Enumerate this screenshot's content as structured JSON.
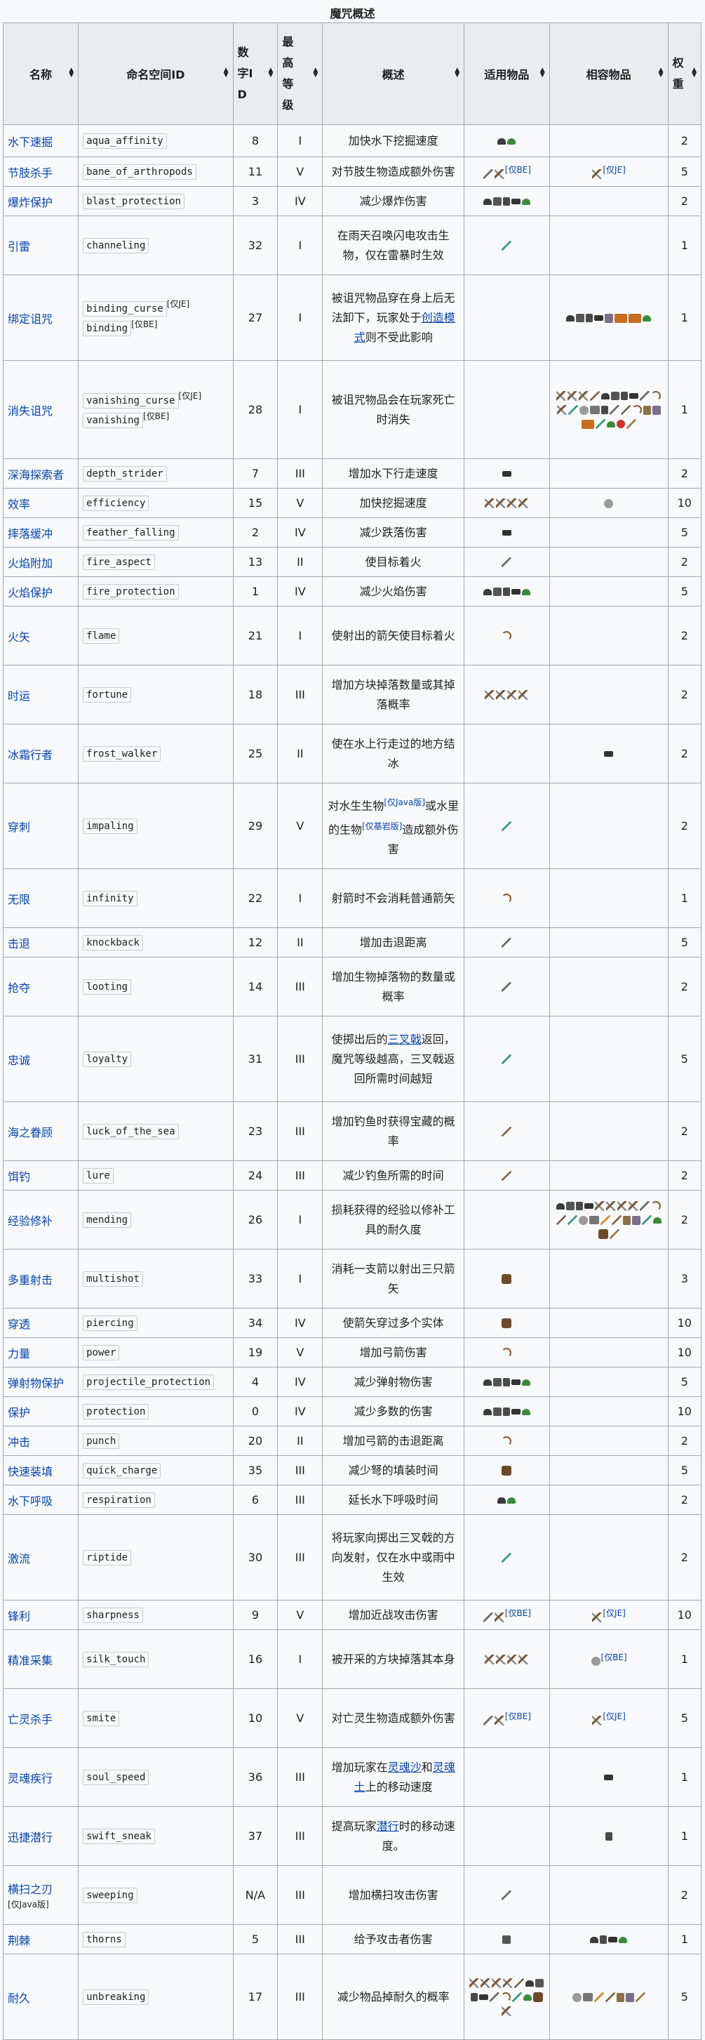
{
  "caption": "魔咒概述",
  "headers": {
    "name": "名称",
    "id": "命名空间ID",
    "num": "数字ID",
    "maxlvl": "最高等级",
    "summary": "概述",
    "items": "适用物品",
    "compat": "相容物品",
    "weight": "权重"
  },
  "icons_note": "Item icons shown as small pictograms",
  "rows": [
    {
      "name": "水下速掘",
      "ids": [
        "aqua_affinity"
      ],
      "num": "8",
      "lvl": "I",
      "summary": "加快水下挖掘速度",
      "wt": "2",
      "items": [
        "helm",
        "turtle"
      ],
      "compat": []
    },
    {
      "name": "节肢杀手",
      "ids": [
        "bane_of_arthropods"
      ],
      "num": "11",
      "lvl": "V",
      "summary": "对节肢生物造成额外伤害",
      "wt": "5",
      "items": [
        "sword",
        "pick"
      ],
      "items_note": "[仅BE]",
      "compat": [
        "pick"
      ],
      "compat_note": "[仅JE]"
    },
    {
      "name": "爆炸保护",
      "ids": [
        "blast_protection"
      ],
      "num": "3",
      "lvl": "IV",
      "summary": "减少爆炸伤害",
      "wt": "2",
      "items": [
        "helm",
        "chest",
        "legs",
        "boots",
        "turtle"
      ],
      "compat": []
    },
    {
      "name": "引雷",
      "ids": [
        "channeling"
      ],
      "num": "32",
      "lvl": "I",
      "summary": "在雨天召唤闪电攻击生物，仅在雷暴时生效",
      "wt": "1",
      "items": [
        "trident"
      ],
      "compat": []
    },
    {
      "name": "绑定诅咒",
      "ids": [
        "binding_curse",
        "binding"
      ],
      "id_notes": [
        "[仅JE]",
        "[仅BE]"
      ],
      "num": "27",
      "lvl": "I",
      "summary_parts": [
        "被诅咒物品穿在身上后无法卸下，玩家处于",
        "创造模式",
        "则不受此影响"
      ],
      "wt": "1",
      "items": [],
      "compat": [
        "helm",
        "chest",
        "legs",
        "boots",
        "elytra",
        "pump",
        "pump",
        "turtle"
      ]
    },
    {
      "name": "消失诅咒",
      "ids": [
        "vanishing_curse",
        "vanishing"
      ],
      "id_notes": [
        "[仅JE]",
        "[仅BE]"
      ],
      "num": "28",
      "lvl": "I",
      "summary": "被诅咒物品会在玩家死亡时消失",
      "wt": "1",
      "items": [],
      "compat": [
        "pick",
        "pick",
        "pick",
        "rod",
        "helm",
        "chest",
        "legs",
        "boots",
        "sword",
        "bow",
        "pick",
        "trident",
        "shears",
        "flint",
        "legs",
        "sword",
        "rod",
        "bow",
        "shield",
        "elytra",
        "pump",
        "trident",
        "turtle",
        "compass",
        "brush"
      ]
    },
    {
      "name": "深海探索者",
      "ids": [
        "depth_strider"
      ],
      "num": "7",
      "lvl": "III",
      "summary": "增加水下行走速度",
      "wt": "2",
      "items": [
        "boots"
      ],
      "compat": []
    },
    {
      "name": "效率",
      "ids": [
        "efficiency"
      ],
      "num": "15",
      "lvl": "V",
      "summary": "加快挖掘速度",
      "wt": "10",
      "items": [
        "pick",
        "pick",
        "pick",
        "pick"
      ],
      "compat": [
        "shears"
      ]
    },
    {
      "name": "摔落缓冲",
      "ids": [
        "feather_falling"
      ],
      "num": "2",
      "lvl": "IV",
      "summary": "减少跌落伤害",
      "wt": "5",
      "items": [
        "boots"
      ],
      "compat": []
    },
    {
      "name": "火焰附加",
      "ids": [
        "fire_aspect"
      ],
      "num": "13",
      "lvl": "II",
      "summary": "使目标着火",
      "wt": "2",
      "items": [
        "sword"
      ],
      "compat": []
    },
    {
      "name": "火焰保护",
      "ids": [
        "fire_protection"
      ],
      "num": "1",
      "lvl": "IV",
      "summary": "减少火焰伤害",
      "wt": "5",
      "items": [
        "helm",
        "chest",
        "legs",
        "boots",
        "turtle"
      ],
      "compat": []
    },
    {
      "name": "火矢",
      "ids": [
        "flame"
      ],
      "num": "21",
      "lvl": "I",
      "summary": "使射出的箭矢使目标着火",
      "wt": "2",
      "items": [
        "bow"
      ],
      "compat": []
    },
    {
      "name": "时运",
      "ids": [
        "fortune"
      ],
      "num": "18",
      "lvl": "III",
      "summary": "增加方块掉落数量或其掉落概率",
      "wt": "2",
      "items": [
        "pick",
        "pick",
        "pick",
        "pick"
      ],
      "compat": []
    },
    {
      "name": "冰霜行者",
      "ids": [
        "frost_walker"
      ],
      "num": "25",
      "lvl": "II",
      "summary": "使在水上行走过的地方结冰",
      "wt": "2",
      "items": [],
      "compat": [
        "boots"
      ]
    },
    {
      "name": "穿刺",
      "ids": [
        "impaling"
      ],
      "num": "29",
      "lvl": "V",
      "summary_parts": [
        "对水生生物",
        "[仅Java版]",
        "或水里的生物",
        "[仅基岩版]",
        "造成额外伤害"
      ],
      "wt": "2",
      "items": [
        "trident"
      ],
      "compat": []
    },
    {
      "name": "无限",
      "ids": [
        "infinity"
      ],
      "num": "22",
      "lvl": "I",
      "summary": "射箭时不会消耗普通箭矢",
      "wt": "1",
      "items": [
        "bow"
      ],
      "compat": []
    },
    {
      "name": "击退",
      "ids": [
        "knockback"
      ],
      "num": "12",
      "lvl": "II",
      "summary": "增加击退距离",
      "wt": "5",
      "items": [
        "sword"
      ],
      "compat": []
    },
    {
      "name": "抢夺",
      "ids": [
        "looting"
      ],
      "num": "14",
      "lvl": "III",
      "summary": "增加生物掉落物的数量或概率",
      "wt": "2",
      "items": [
        "sword"
      ],
      "compat": []
    },
    {
      "name": "忠诚",
      "ids": [
        "loyalty"
      ],
      "num": "31",
      "lvl": "III",
      "summary_parts": [
        "使掷出后的",
        "三叉戟",
        "返回，魔咒等级越高，三叉戟返回所需时间越短"
      ],
      "wt": "5",
      "items": [
        "trident"
      ],
      "compat": []
    },
    {
      "name": "海之眷顾",
      "ids": [
        "luck_of_the_sea"
      ],
      "num": "23",
      "lvl": "III",
      "summary": "增加钓鱼时获得宝藏的概率",
      "wt": "2",
      "items": [
        "rod"
      ],
      "compat": []
    },
    {
      "name": "饵钓",
      "ids": [
        "lure"
      ],
      "num": "24",
      "lvl": "III",
      "summary": "减少钓鱼所需的时间",
      "wt": "2",
      "items": [
        "rod"
      ],
      "compat": []
    },
    {
      "name": "经验修补",
      "ids": [
        "mending"
      ],
      "num": "26",
      "lvl": "I",
      "summary": "损耗获得的经验以修补工具的耐久度",
      "wt": "2",
      "items": [],
      "compat": [
        "helm",
        "chest",
        "legs",
        "boots",
        "pick",
        "pick",
        "pick",
        "pick",
        "sword",
        "bow",
        "rod",
        "trident",
        "shears",
        "flint",
        "carrot",
        "rod",
        "shield",
        "elytra",
        "trident",
        "turtle",
        "cross",
        "brush"
      ]
    },
    {
      "name": "多重射击",
      "ids": [
        "multishot"
      ],
      "num": "33",
      "lvl": "I",
      "summary": "消耗一支箭以射出三只箭矢",
      "wt": "3",
      "items": [
        "cross"
      ],
      "compat": []
    },
    {
      "name": "穿透",
      "ids": [
        "piercing"
      ],
      "num": "34",
      "lvl": "IV",
      "summary": "使箭矢穿过多个实体",
      "wt": "10",
      "items": [
        "cross"
      ],
      "compat": []
    },
    {
      "name": "力量",
      "ids": [
        "power"
      ],
      "num": "19",
      "lvl": "V",
      "summary": "增加弓箭伤害",
      "wt": "10",
      "items": [
        "bow"
      ],
      "compat": []
    },
    {
      "name": "弹射物保护",
      "ids": [
        "projectile_protection"
      ],
      "num": "4",
      "lvl": "IV",
      "summary": "减少弹射物伤害",
      "wt": "5",
      "items": [
        "helm",
        "chest",
        "legs",
        "boots",
        "turtle"
      ],
      "compat": []
    },
    {
      "name": "保护",
      "ids": [
        "protection"
      ],
      "num": "0",
      "lvl": "IV",
      "summary": "减少多数的伤害",
      "wt": "10",
      "items": [
        "helm",
        "chest",
        "legs",
        "boots",
        "turtle"
      ],
      "compat": []
    },
    {
      "name": "冲击",
      "ids": [
        "punch"
      ],
      "num": "20",
      "lvl": "II",
      "summary": "增加弓箭的击退距离",
      "wt": "2",
      "items": [
        "bow"
      ],
      "compat": []
    },
    {
      "name": "快速装填",
      "ids": [
        "quick_charge"
      ],
      "num": "35",
      "lvl": "III",
      "summary": "减少弩的填装时间",
      "wt": "5",
      "items": [
        "cross"
      ],
      "compat": []
    },
    {
      "name": "水下呼吸",
      "ids": [
        "respiration"
      ],
      "num": "6",
      "lvl": "III",
      "summary": "延长水下呼吸时间",
      "wt": "2",
      "items": [
        "helm",
        "turtle"
      ],
      "compat": []
    },
    {
      "name": "激流",
      "ids": [
        "riptide"
      ],
      "num": "30",
      "lvl": "III",
      "summary": "将玩家向掷出三叉戟的方向发射，仅在水中或雨中生效",
      "wt": "2",
      "items": [
        "trident"
      ],
      "compat": []
    },
    {
      "name": "锋利",
      "ids": [
        "sharpness"
      ],
      "num": "9",
      "lvl": "V",
      "summary": "增加近战攻击伤害",
      "wt": "10",
      "items": [
        "sword",
        "pick"
      ],
      "items_note": "[仅BE]",
      "compat": [
        "pick"
      ],
      "compat_note": "[仅JE]"
    },
    {
      "name": "精准采集",
      "ids": [
        "silk_touch"
      ],
      "num": "16",
      "lvl": "I",
      "summary": "被开采的方块掉落其本身",
      "wt": "1",
      "items": [
        "pick",
        "pick",
        "pick",
        "pick"
      ],
      "compat": [
        "shears"
      ],
      "compat_note": "[仅BE]"
    },
    {
      "name": "亡灵杀手",
      "ids": [
        "smite"
      ],
      "num": "10",
      "lvl": "V",
      "summary": "对亡灵生物造成额外伤害",
      "wt": "5",
      "items": [
        "sword",
        "pick"
      ],
      "items_note": "[仅BE]",
      "compat": [
        "pick"
      ],
      "compat_note": "[仅JE]"
    },
    {
      "name": "灵魂疾行",
      "ids": [
        "soul_speed"
      ],
      "num": "36",
      "lvl": "III",
      "summary_parts": [
        "增加玩家在",
        "灵魂沙",
        "和",
        "灵魂土",
        "上的移动速度"
      ],
      "wt": "1",
      "items": [],
      "compat": [
        "boots"
      ]
    },
    {
      "name": "迅捷潜行",
      "ids": [
        "swift_sneak"
      ],
      "num": "37",
      "lvl": "III",
      "summary_parts": [
        "提高玩家",
        "潜行",
        "时的移动速度。"
      ],
      "wt": "1",
      "items": [],
      "compat": [
        "legs"
      ]
    },
    {
      "name": "横扫之刃",
      "name_note": "[仅Java版]",
      "ids": [
        "sweeping"
      ],
      "num": "N/A",
      "lvl": "III",
      "summary": "增加横扫攻击伤害",
      "wt": "2",
      "items": [
        "sword"
      ],
      "compat": []
    },
    {
      "name": "荆棘",
      "ids": [
        "thorns"
      ],
      "num": "5",
      "lvl": "III",
      "summary": "给予攻击者伤害",
      "wt": "1",
      "items": [
        "chest"
      ],
      "compat": [
        "helm",
        "legs",
        "boots",
        "turtle"
      ]
    },
    {
      "name": "耐久",
      "ids": [
        "unbreaking"
      ],
      "num": "17",
      "lvl": "III",
      "summary": "减少物品掉耐久的概率",
      "wt": "5",
      "items": [
        "pick",
        "pick",
        "pick",
        "pick",
        "rod",
        "helm",
        "chest",
        "legs",
        "boots",
        "sword",
        "bow",
        "trident",
        "turtle",
        "cross",
        "pick"
      ],
      "compat": [
        "shears",
        "flint",
        "carrot",
        "rod",
        "shield",
        "elytra",
        "brush"
      ]
    }
  ]
}
